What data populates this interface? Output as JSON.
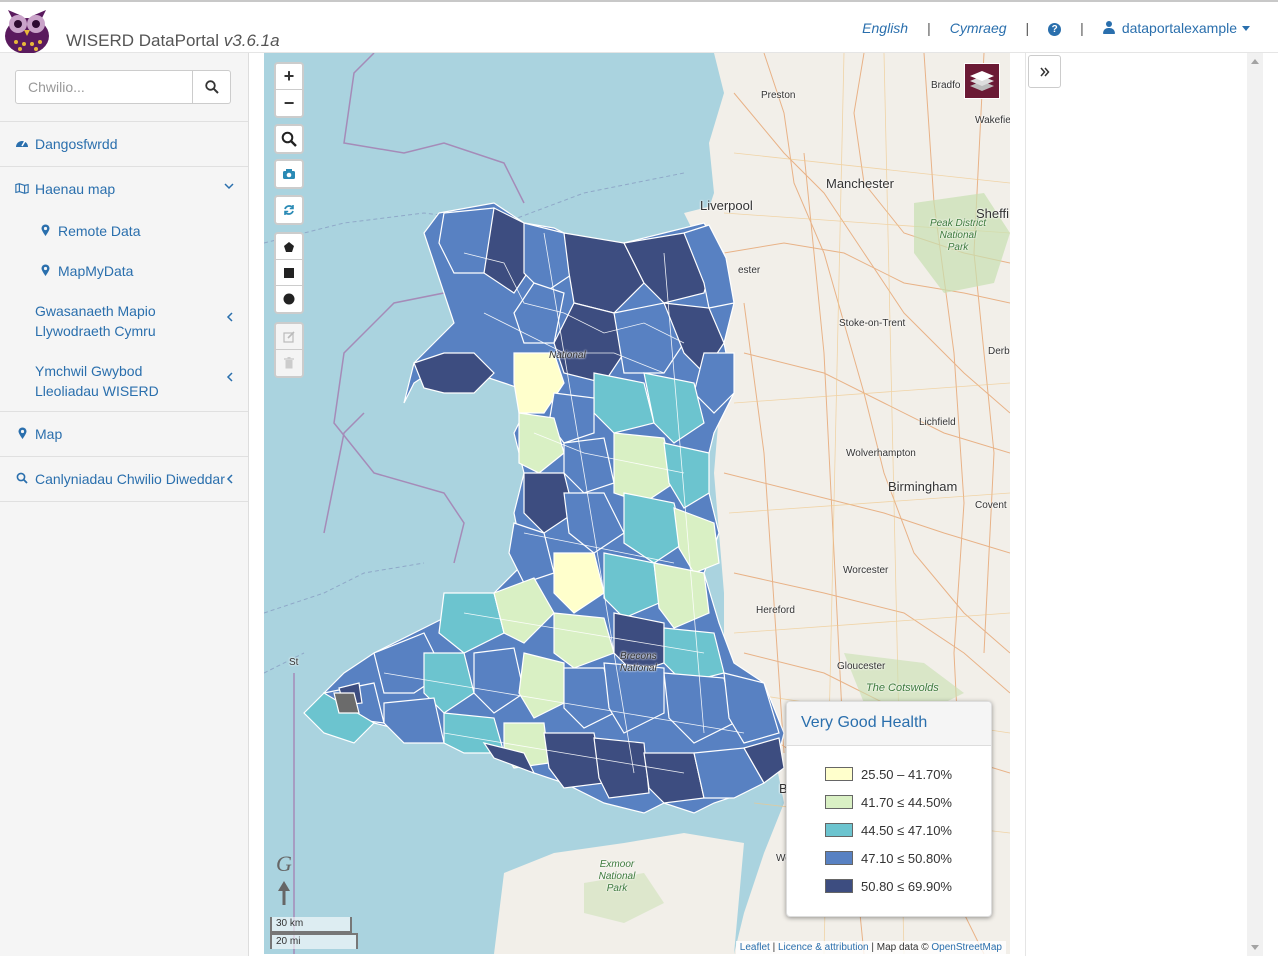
{
  "header": {
    "brand": "WISERD DataPortal",
    "version": "v3.6.1a",
    "nav": {
      "english": "English",
      "cymraeg": "Cymraeg",
      "sep": "|",
      "user": "dataportalexample"
    }
  },
  "sidebar": {
    "search_placeholder": "Chwilio...",
    "items": [
      {
        "label": "Dangosfwrdd",
        "icon": "dashboard-icon"
      },
      {
        "label": "Haenau map",
        "icon": "map-icon"
      },
      {
        "label": "Remote Data",
        "icon": "map-marker-icon"
      },
      {
        "label": "MapMyData",
        "icon": "map-marker-icon"
      },
      {
        "label": "Gwasanaeth Mapio Llywodraeth Cymru"
      },
      {
        "label": "Ymchwil Gwybod Lleoliadau WISERD"
      },
      {
        "label": "Map",
        "icon": "map-marker-icon"
      },
      {
        "label": "Canlyniadau Chwilio Diweddar",
        "icon": "search-icon"
      }
    ]
  },
  "map": {
    "places": {
      "preston": "Preston",
      "bradford": "Bradfo",
      "wakefield": "Wakefie",
      "manchester": "Manchester",
      "liverpool": "Liverpool",
      "sheffield": "Sheffi",
      "peak": "Peak District National Park",
      "chester": "ester",
      "stoke": "Stoke-on-Trent",
      "derby": "Derb",
      "lichfield": "Lichfield",
      "wolverhampton": "Wolverhampton",
      "birmingham": "Birmingham",
      "coventry": "Covent",
      "worcester": "Worcester",
      "hereford": "Hereford",
      "gloucester": "Gloucester",
      "cotswolds": "The Cotswolds",
      "exmoor": "Exmoor National Park",
      "snowdonia": "National",
      "brecon": "Brecons National",
      "st": "St",
      "we": "We",
      "b": "B"
    },
    "scale_km": "30 km",
    "scale_mi": "20 mi",
    "attribution": {
      "leaflet": "Leaflet",
      "licence": "Licence & attribution",
      "mapdata": "Map data ©",
      "osm": "OpenStreetMap"
    },
    "legend": {
      "title": "Very Good Health",
      "items": [
        {
          "label": "25.50 – 41.70%",
          "color": "#ffffcc"
        },
        {
          "label": "41.70 ≤ 44.50%",
          "color": "#d9f0c4"
        },
        {
          "label": "44.50 ≤ 47.10%",
          "color": "#6cc4cf"
        },
        {
          "label": "47.10 ≤ 50.80%",
          "color": "#5881c2"
        },
        {
          "label": "50.80 ≤ 69.90%",
          "color": "#3d4d80"
        }
      ]
    }
  },
  "colors": {
    "accent": "#2a6fad",
    "layers": "#6b1a35",
    "sea": "#aad3df",
    "land": "#f2efe9"
  }
}
